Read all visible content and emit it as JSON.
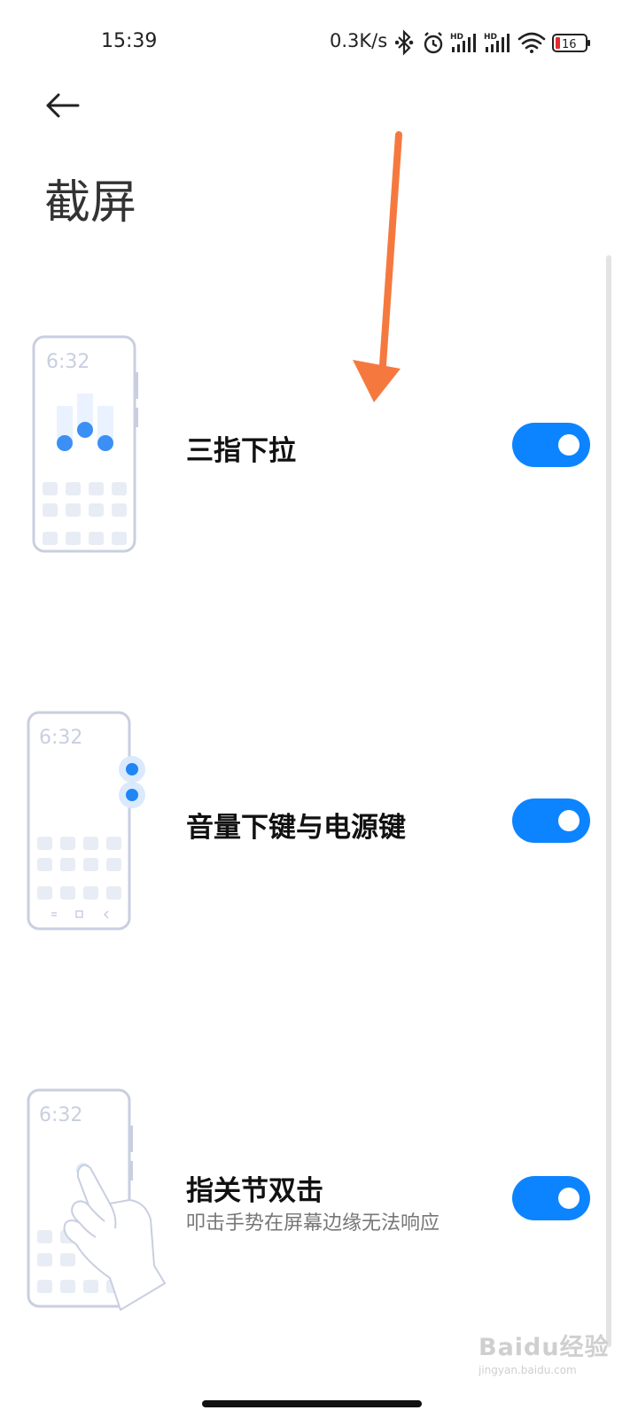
{
  "status_bar": {
    "time": "15:39",
    "net_speed": "0.3K/s",
    "battery_level": "16",
    "hd_label_1": "HD",
    "hd_label_2": "HD",
    "icons": [
      "bluetooth-icon",
      "alarm-icon",
      "signal-hd-icon",
      "signal-hd-icon",
      "wifi-icon",
      "battery-icon"
    ]
  },
  "header": {
    "title": "截屏"
  },
  "options": [
    {
      "label": "三指下拉",
      "enabled": true,
      "illus_time": "6:32"
    },
    {
      "label": "音量下键与电源键",
      "enabled": true,
      "illus_time": "6:32"
    },
    {
      "label": "指关节双击",
      "subtitle": "叩击手势在屏幕边缘无法响应",
      "enabled": true,
      "illus_time": "6:32"
    }
  ],
  "annotation": {
    "color": "#f5793f"
  },
  "watermark": {
    "main": "Baidu经验",
    "sub": "jingyan.baidu.com"
  },
  "colors": {
    "accent": "#0d84ff",
    "illustration": "#c9cfe0"
  }
}
